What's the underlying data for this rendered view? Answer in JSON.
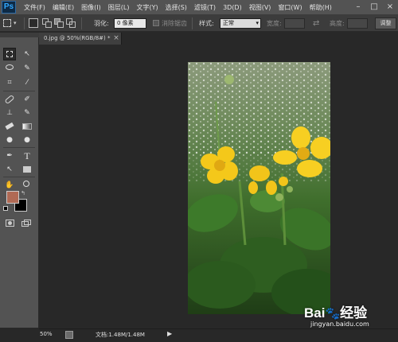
{
  "app": {
    "logo": "Ps"
  },
  "menu": [
    "文件(F)",
    "编辑(E)",
    "图像(I)",
    "图层(L)",
    "文字(Y)",
    "选择(S)",
    "滤镜(T)",
    "3D(D)",
    "视图(V)",
    "窗口(W)",
    "帮助(H)"
  ],
  "window_controls": [
    "–",
    "□",
    "×"
  ],
  "options": {
    "feather_label": "羽化:",
    "feather_value": "0 像素",
    "antialias_label": "消除锯齿",
    "style_label": "样式:",
    "style_value": "正常",
    "width_label": "宽度:",
    "height_label": "高度:",
    "swap_icon": "⇄",
    "refine_button": "调整"
  },
  "document": {
    "tab_label": "0.jpg @ 50%(RGB/8#) *",
    "close_glyph": "×"
  },
  "status": {
    "zoom": "50%",
    "doc_size": "文档:1.48M/1.48M",
    "arrow": "▶"
  },
  "colors": {
    "foreground": "#b06a55",
    "background": "#000000"
  },
  "watermark": {
    "logo": "Bai",
    "logo_suffix": "经验",
    "url": "jingyan.baidu.com"
  }
}
